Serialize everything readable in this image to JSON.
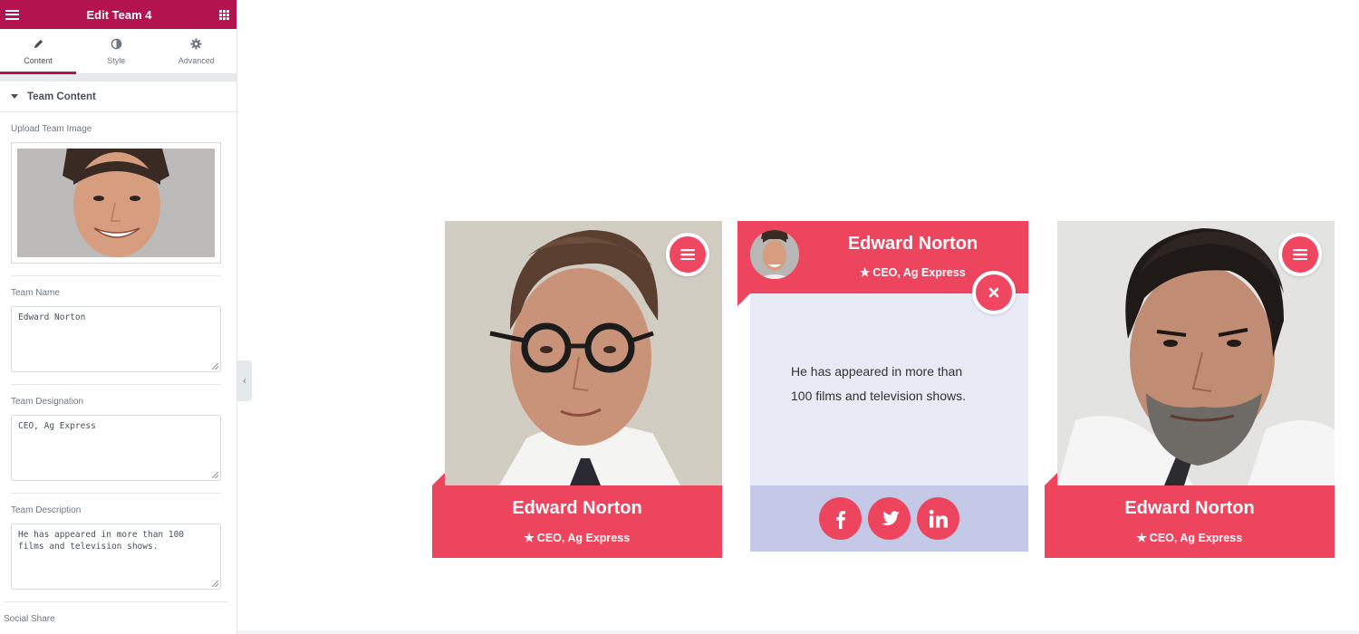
{
  "editor": {
    "title": "Edit Team 4",
    "tabs": [
      {
        "label": "Content",
        "icon": "pencil-icon"
      },
      {
        "label": "Style",
        "icon": "contrast-icon"
      },
      {
        "label": "Advanced",
        "icon": "gear-icon"
      }
    ],
    "section_title": "Team Content",
    "image_label": "Upload Team Image",
    "name_label": "Team Name",
    "name_value": "Edward Norton",
    "designation_label": "Team Designation",
    "designation_value": "CEO, Ag Express",
    "description_label": "Team Description",
    "description_value": "He has appeared in more than 100\nfilms and television shows.",
    "social_label": "Social Share"
  },
  "cards": [
    {
      "name": "Edward Norton",
      "designation": "CEO, Ag Express"
    },
    {
      "name": "Edward Norton",
      "designation": "CEO, Ag Express",
      "description_line1": "He has appeared in more than",
      "description_line2": "100 films and television shows.",
      "social": [
        "facebook-icon",
        "twitter-icon",
        "linkedin-icon"
      ]
    },
    {
      "name": "Edward Norton",
      "designation": "CEO, Ag Express"
    }
  ],
  "colors": {
    "brand": "#b3134f",
    "accent": "#ee455f",
    "info_panel": "#e8eaf6",
    "social_panel": "#c5c9e8"
  }
}
